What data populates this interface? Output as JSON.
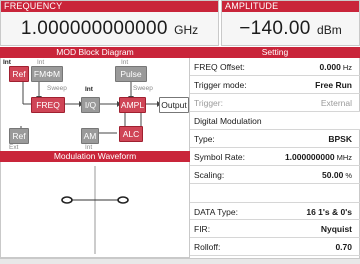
{
  "frequency": {
    "label": "FREQUENCY",
    "value": "1.000000000000",
    "unit": "GHz"
  },
  "amplitude": {
    "label": "AMPLITUDE",
    "value": "−140.00",
    "unit": "dBm"
  },
  "block_diagram": {
    "title": "MOD Block Diagram",
    "blocks": {
      "ref_top": "Ref",
      "fm_phim": "FMΦM",
      "pulse": "Pulse",
      "freq": "FREQ",
      "iq": "I/Q",
      "ampl": "AMPL",
      "output": "Output",
      "ref_bottom": "Ref",
      "am": "AM",
      "alc": "ALC"
    },
    "tags": {
      "int_1": "Int",
      "int_2": "Int",
      "int_3": "Int",
      "int_4": "Int",
      "int_5": "Int",
      "sweep_1": "Sweep",
      "sweep_2": "Sweep",
      "ext": "Ext"
    }
  },
  "waveform": {
    "title": "Modulation Waveform"
  },
  "settings": {
    "title": "Setting",
    "rows": [
      {
        "label": "FREQ Offset:",
        "value": "0.000",
        "unit": "Hz"
      },
      {
        "label": "Trigger mode:",
        "value": "Free Run"
      },
      {
        "label": "Trigger:",
        "value": "External"
      },
      {
        "label": "Digital Modulation"
      },
      {
        "label": "Type:",
        "value": "BPSK"
      },
      {
        "label": "Symbol Rate:",
        "value": "1.000000000",
        "unit": "MHz"
      },
      {
        "label": "Scaling:",
        "value": "50.00",
        "unit": "%"
      },
      {
        "label": "DATA Type:",
        "value": "16 1's & 0's"
      },
      {
        "label": "FIR:",
        "value": "Nyquist"
      },
      {
        "label": "Rolloff:",
        "value": "0.70"
      }
    ]
  },
  "colors": {
    "accent": "#c9253a",
    "block_active": "#cf4556",
    "block_inactive": "#9a9a9a"
  }
}
